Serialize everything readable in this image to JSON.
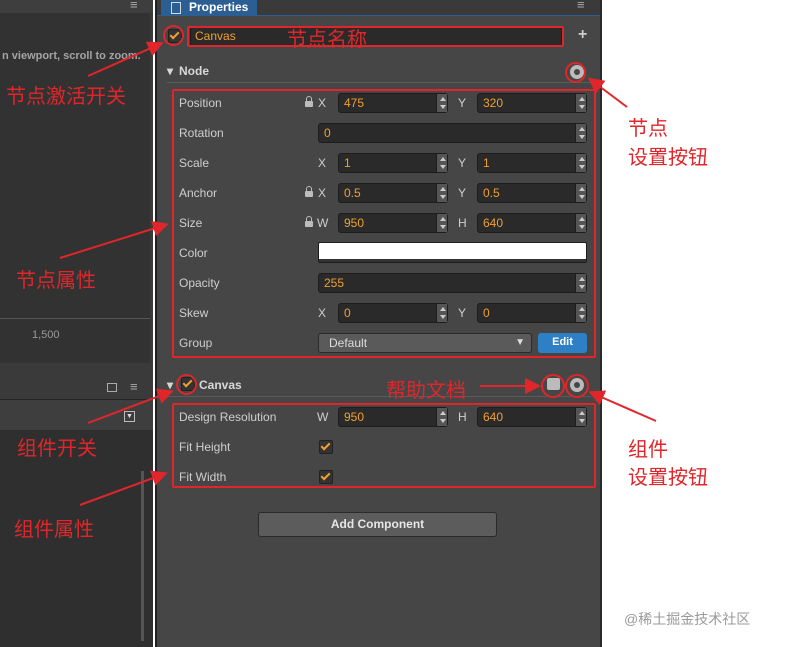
{
  "window": {
    "tab_title": "Properties",
    "menu_glyph": "≡"
  },
  "viewport": {
    "hint": "n viewport, scroll to zoom.",
    "tick_label": "1,500"
  },
  "node_header": {
    "active_checked": true,
    "name": "Canvas",
    "add_button": "+"
  },
  "node_section": {
    "title": "Node",
    "properties": {
      "position": {
        "label": "Position",
        "x_label": "X",
        "x": "475",
        "y_label": "Y",
        "y": "320"
      },
      "rotation": {
        "label": "Rotation",
        "value": "0"
      },
      "scale": {
        "label": "Scale",
        "x_label": "X",
        "x": "1",
        "y_label": "Y",
        "y": "1"
      },
      "anchor": {
        "label": "Anchor",
        "x_label": "X",
        "x": "0.5",
        "y_label": "Y",
        "y": "0.5"
      },
      "size": {
        "label": "Size",
        "w_label": "W",
        "w": "950",
        "h_label": "H",
        "h": "640"
      },
      "color": {
        "label": "Color",
        "value": "#ffffff"
      },
      "opacity": {
        "label": "Opacity",
        "value": "255"
      },
      "skew": {
        "label": "Skew",
        "x_label": "X",
        "x": "0",
        "y_label": "Y",
        "y": "0"
      },
      "group": {
        "label": "Group",
        "value": "Default",
        "edit_label": "Edit"
      }
    }
  },
  "component": {
    "title": "Canvas",
    "enabled": true,
    "design_resolution": {
      "label": "Design Resolution",
      "w_label": "W",
      "w": "950",
      "h_label": "H",
      "h": "640"
    },
    "fit_height": {
      "label": "Fit Height",
      "checked": true
    },
    "fit_width": {
      "label": "Fit Width",
      "checked": true
    }
  },
  "add_component_label": "Add Component",
  "annotations": {
    "node_name": "节点名称",
    "node_active": "节点激活开关",
    "node_settings_1": "节点",
    "node_settings_2": "设置按钮",
    "node_properties": "节点属性",
    "help_docs": "帮助文档",
    "component_switch": "组件开关",
    "component_settings_1": "组件",
    "component_settings_2": "设置按钮",
    "component_properties": "组件属性"
  },
  "watermark": "@稀土掘金技术社区",
  "colors": {
    "accent": "#f0a030",
    "annotation": "#e0262a",
    "tab_blue": "#2b5f94",
    "edit_blue": "#2d7fc6"
  }
}
